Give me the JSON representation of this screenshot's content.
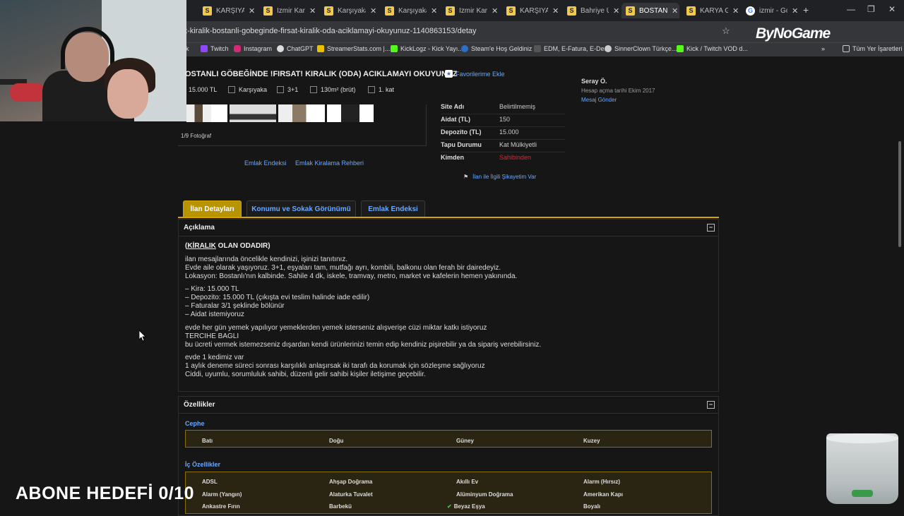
{
  "browser": {
    "tabs": [
      {
        "title": "KARŞIYAKA",
        "icon": "S"
      },
      {
        "title": "İzmir Karşıyaka",
        "icon": "S"
      },
      {
        "title": "Karşıyaka",
        "icon": "S"
      },
      {
        "title": "Karşıyaka",
        "icon": "S"
      },
      {
        "title": "İzmir Karşıyaka",
        "icon": "S"
      },
      {
        "title": "KARŞIYAKA",
        "icon": "S"
      },
      {
        "title": "Bahriye Üçok",
        "icon": "S"
      },
      {
        "title": "BOSTANLI",
        "icon": "S"
      },
      {
        "title": "KARYA GM",
        "icon": "S"
      },
      {
        "title": "izmir - Go",
        "icon": "G"
      }
    ],
    "url": "t-kiralik-bostanli-gobeginde-firsat-kiralik-oda-aciklamayi-okuyunuz-1140863153/detay",
    "overlay_brand": "ByNoGame",
    "bookmarks": [
      "k",
      "Twitch",
      "Instagram",
      "ChatGPT",
      "StreamerStats.com |...",
      "KickLogz - Kick Yayı...",
      "Steam'e Hoş Geldiniz",
      "EDM, E-Fatura, E-De...",
      "SinnerClown Türkçe...",
      "Kick / Twitch VOD d..."
    ],
    "bookmarks_more": "»",
    "all_bookmarks": "Tüm Yer İşaretleri"
  },
  "listing": {
    "title": "OSTANLI GÖBEĞİNDE !FIRSAT! KIRALIK (ODA) ACIKLAMAYI OKUYUNUZ",
    "favorite_label": "Favorilerime Ekle",
    "meta": [
      "15.000 TL",
      "Karşıyaka",
      "3+1",
      "130m² (brüt)",
      "1. kat"
    ],
    "photo_count": "1/9 Fotoğraf",
    "details": [
      {
        "key": "Site Adı",
        "value": "Belirtilmemiş"
      },
      {
        "key": "Aidat (TL)",
        "value": "150"
      },
      {
        "key": "Depozito (TL)",
        "value": "15.000"
      },
      {
        "key": "Tapu Durumu",
        "value": "Kat Mülkiyetli"
      },
      {
        "key": "Kimden",
        "value": "Sahibinden"
      }
    ],
    "complaint_link": "İlan ile İlgili Şikayetim Var",
    "index_links": [
      "Emlak Endeksi",
      "Emlak Kiralama Rehberi"
    ]
  },
  "seller": {
    "name": "Seray Ö.",
    "since": "Hesap açma tarihi  Ekim 2017",
    "message": "Mesaj Gönder"
  },
  "page_tabs": [
    "İlan Detayları",
    "Konumu ve Sokak Görünümü",
    "Emlak Endeksi"
  ],
  "description": {
    "section_title": "Açıklama",
    "collapse": "−",
    "heading_underlined": "KİRALIK",
    "heading_rest": " OLAN ODADIR)",
    "heading_open": "(",
    "paragraphs": [
      [
        "ilan mesajlarında öncelikle kendinizi, işinizi tanıtınız.",
        "Evde aile olarak yaşıyoruz. 3+1, eşyaları tam, mutfağı ayrı, kombili, balkonu olan ferah bir dairedeyiz.",
        "Lokasyon: Bostanlı'nın kalbinde. Sahile 4 dk, iskele, tramvay, metro, market ve kafelerin hemen yakınında."
      ],
      [
        "– Kira: 15.000 TL",
        "– Depozito: 15.000 TL (çıkışta evi teslim halinde iade edilir)",
        "– Faturalar 3/1 şeklinde bölünür",
        "– Aidat istemiyoruz"
      ],
      [
        "evde her gün yemek yapılıyor yemeklerden yemek isterseniz alışverişe cüzi miktar katkı istiyoruz",
        "TERCIHE BAGLI",
        "bu ücreti vermek istemezseniz dışardan kendi ürünlerinizi temin edip kendiniz pişirebilir ya da sipariş verebilirsiniz."
      ],
      [
        "evde 1 kedimiz var",
        "1 aylık deneme süreci sonrası karşılıklı anlaşırsak iki tarafı da korumak için sözleşme sağlıyoruz",
        "Ciddi, uyumlu, sorumluluk sahibi, düzenli gelir sahibi kişiler iletişime geçebilir."
      ]
    ]
  },
  "features": {
    "section_title": "Özellikler",
    "collapse": "−",
    "cephe_label": "Cephe",
    "cephe": [
      "Batı",
      "Doğu",
      "Güney",
      "Kuzey"
    ],
    "ic_label": "İç Özellikler",
    "ic": [
      "ADSL",
      "Ahşap Doğrama",
      "Akıllı Ev",
      "Alarm (Hırsız)",
      "Alarm (Yangın)",
      "Alaturka Tuvalet",
      "Alüminyum Doğrama",
      "Amerikan Kapı",
      "Ankastre Fırın",
      "Barbekü",
      "Beyaz Eşya",
      "Boyalı"
    ],
    "checked_item": "Beyaz Eşya"
  },
  "overlay": {
    "subscriber_goal": "ABONE HEDEFİ 0/10"
  },
  "colors": {
    "accent": "#d4a400",
    "link": "#6aa8ff",
    "seller_red": "#e0262c"
  }
}
